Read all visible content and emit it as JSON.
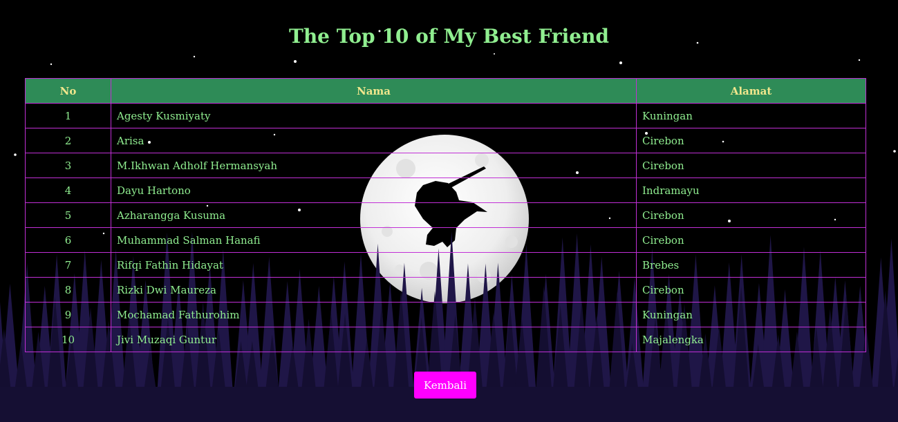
{
  "page": {
    "title": "The Top 10 of My Best Friend"
  },
  "table": {
    "headers": {
      "no": "No",
      "nama": "Nama",
      "alamat": "Alamat"
    },
    "rows": [
      {
        "no": "1",
        "nama": "Agesty Kusmiyaty",
        "alamat": "Kuningan"
      },
      {
        "no": "2",
        "nama": "Arisa",
        "alamat": "Cirebon"
      },
      {
        "no": "3",
        "nama": "M.Ikhwan Adholf Hermansyah",
        "alamat": "Cirebon"
      },
      {
        "no": "4",
        "nama": "Dayu Hartono",
        "alamat": "Indramayu"
      },
      {
        "no": "5",
        "nama": "Azharangga Kusuma",
        "alamat": "Cirebon"
      },
      {
        "no": "6",
        "nama": "Muhammad Salman Hanafi",
        "alamat": "Cirebon"
      },
      {
        "no": "7",
        "nama": "Rifqi Fathin Hidayat",
        "alamat": "Brebes"
      },
      {
        "no": "8",
        "nama": "Rizki Dwi Maureza",
        "alamat": "Cirebon"
      },
      {
        "no": "9",
        "nama": "Mochamad Fathurohim",
        "alamat": "Kuningan"
      },
      {
        "no": "10",
        "nama": "Jivi Muzaqi Guntur",
        "alamat": "Majalengka"
      }
    ]
  },
  "button": {
    "label": "Kembali"
  },
  "colors": {
    "background": "#000000",
    "title": "#90ee90",
    "header_bg": "#2e8b57",
    "header_text": "#f0e68c",
    "cell_text": "#90ee90",
    "border": "#c12fd6",
    "button_bg": "#ff00ff",
    "forest": "#1a1238"
  },
  "background_art": [
    "night-sky-stars",
    "full-moon",
    "ninja-silhouette",
    "pine-forest"
  ]
}
